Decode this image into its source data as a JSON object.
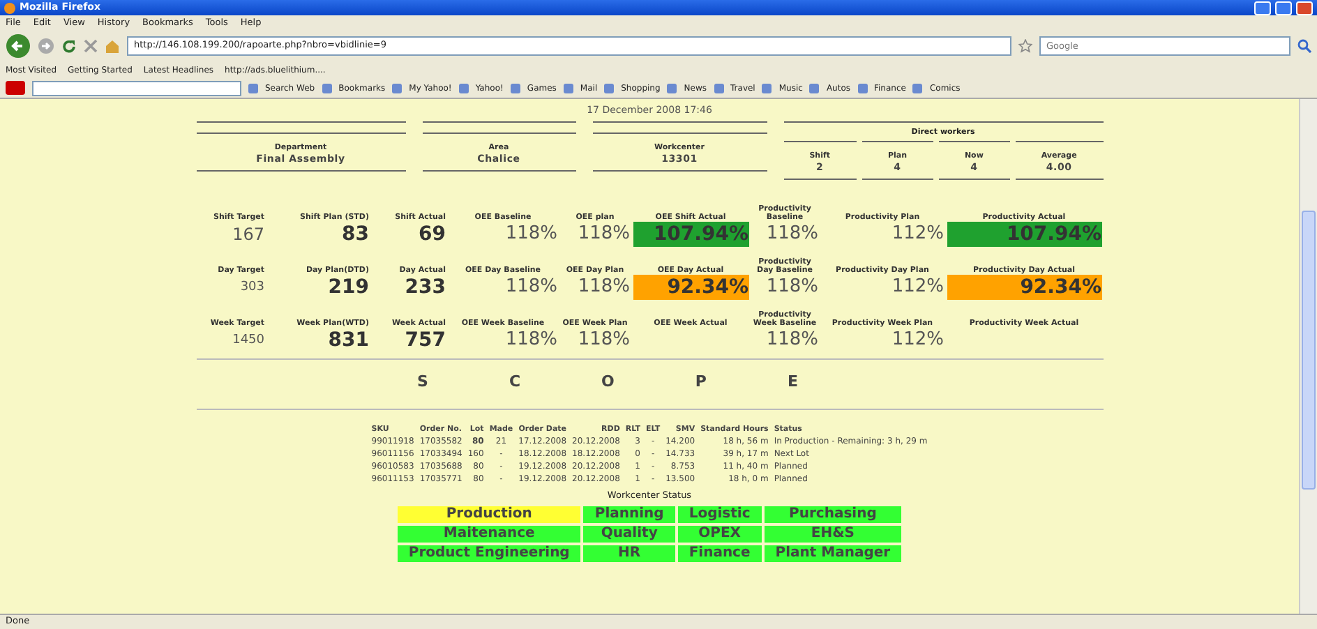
{
  "browser": {
    "title": "Mozilla Firefox",
    "menu": [
      "File",
      "Edit",
      "View",
      "History",
      "Bookmarks",
      "Tools",
      "Help"
    ],
    "url": "http://146.108.199.200/rapoarte.php?nbro=vbidlinie=9",
    "search_placeholder": "Google",
    "bookmarks": [
      "Most Visited",
      "Getting Started",
      "Latest Headlines",
      "http://ads.bluelithium...."
    ],
    "yahoo_toolbar": [
      "Search Web",
      "Bookmarks",
      "My Yahoo!",
      "Yahoo!",
      "Games",
      "Mail",
      "Shopping",
      "News",
      "Travel",
      "Music",
      "Autos",
      "Finance",
      "Comics"
    ],
    "status": "Done"
  },
  "page": {
    "timestamp": "17 December 2008 17:46",
    "info": [
      {
        "label": "Department",
        "value": "Final Assembly"
      },
      {
        "label": "Area",
        "value": "Chalice"
      },
      {
        "label": "Workcenter",
        "value": "13301"
      }
    ],
    "direct_workers": {
      "title": "Direct workers",
      "columns": [
        {
          "label": "Shift",
          "value": "2"
        },
        {
          "label": "Plan",
          "value": "4"
        },
        {
          "label": "Now",
          "value": "4"
        },
        {
          "label": "Average",
          "value": "4.00"
        }
      ]
    },
    "metrics": [
      [
        {
          "label": "Shift Target",
          "value": "167",
          "kind": "plain"
        },
        {
          "label": "Shift Plan (STD)",
          "value": "83",
          "kind": "bold"
        },
        {
          "label": "Shift Actual",
          "value": "69",
          "kind": "bold"
        },
        {
          "label": "OEE Baseline",
          "value": "118%",
          "kind": "light"
        },
        {
          "label": "OEE plan",
          "value": "118%",
          "kind": "light"
        },
        {
          "label": "OEE Shift Actual",
          "value": "107.94%",
          "kind": "status",
          "color": "#1fa12f"
        },
        {
          "label": "Productivity Baseline",
          "value": "118%",
          "kind": "light"
        },
        {
          "label": "Productivity Plan",
          "value": "112%",
          "kind": "light"
        },
        {
          "label": "Productivity Actual",
          "value": "107.94%",
          "kind": "status",
          "color": "#1fa12f"
        }
      ],
      [
        {
          "label": "Day Target",
          "value": "303",
          "kind": "small"
        },
        {
          "label": "Day Plan(DTD)",
          "value": "219",
          "kind": "bold"
        },
        {
          "label": "Day Actual",
          "value": "233",
          "kind": "bold"
        },
        {
          "label": "OEE Day Baseline",
          "value": "118%",
          "kind": "light"
        },
        {
          "label": "OEE Day Plan",
          "value": "118%",
          "kind": "light"
        },
        {
          "label": "OEE Day Actual",
          "value": "92.34%",
          "kind": "status",
          "color": "#ffa200"
        },
        {
          "label": "Productivity Day Baseline",
          "value": "118%",
          "kind": "light"
        },
        {
          "label": "Productivity Day Plan",
          "value": "112%",
          "kind": "light"
        },
        {
          "label": "Productivity Day Actual",
          "value": "92.34%",
          "kind": "status",
          "color": "#ffa200"
        }
      ],
      [
        {
          "label": "Week Target",
          "value": "1450",
          "kind": "small"
        },
        {
          "label": "Week Plan(WTD)",
          "value": "831",
          "kind": "bold"
        },
        {
          "label": "Week Actual",
          "value": "757",
          "kind": "bold"
        },
        {
          "label": "OEE Week Baseline",
          "value": "118%",
          "kind": "light"
        },
        {
          "label": "OEE Week Plan",
          "value": "118%",
          "kind": "light"
        },
        {
          "label": "OEE Week Actual"
        },
        {
          "label": "Productivity Week Baseline",
          "value": "118%",
          "kind": "light"
        },
        {
          "label": "Productivity Week Plan",
          "value": "112%",
          "kind": "light"
        },
        {
          "label": "Productivity Week Actual"
        }
      ]
    ],
    "scope": [
      "S",
      "C",
      "O",
      "P",
      "E"
    ],
    "orders": {
      "columns": [
        "SKU",
        "Order No.",
        "Lot",
        "Made",
        "Order Date",
        "RDD",
        "RLT",
        "ELT",
        "SMV",
        "Standard Hours",
        "Status"
      ],
      "rows": [
        {
          "current": true,
          "cells": [
            "99011918",
            "17035582",
            "80",
            "21",
            "17.12.2008",
            "20.12.2008",
            "3",
            "-",
            "14.200",
            "18 h, 56 m",
            "In Production - Remaining:  3 h, 29 m"
          ]
        },
        {
          "current": false,
          "cells": [
            "96011156",
            "17033494",
            "160",
            "-",
            "18.12.2008",
            "18.12.2008",
            "0",
            "-",
            "14.733",
            "39 h, 17 m",
            "Next Lot"
          ]
        },
        {
          "current": false,
          "cells": [
            "96010583",
            "17035688",
            "80",
            "-",
            "19.12.2008",
            "20.12.2008",
            "1",
            "-",
            "8.753",
            "11 h, 40 m",
            "Planned"
          ]
        },
        {
          "current": false,
          "cells": [
            "96011153",
            "17035771",
            "80",
            "-",
            "19.12.2008",
            "20.12.2008",
            "1",
            "-",
            "13.500",
            "18 h, 0 m",
            "Planned"
          ]
        }
      ]
    },
    "workcenter_status": {
      "title": "Workcenter Status",
      "rows": [
        [
          {
            "label": "Production",
            "color": "#ffff33"
          },
          {
            "label": "Planning",
            "color": "#33ff33"
          },
          {
            "label": "Logistic",
            "color": "#33ff33"
          },
          {
            "label": "Purchasing",
            "color": "#33ff33"
          }
        ],
        [
          {
            "label": "Maitenance",
            "color": "#33ff33"
          },
          {
            "label": "Quality",
            "color": "#33ff33"
          },
          {
            "label": "OPEX",
            "color": "#33ff33"
          },
          {
            "label": "EH&S",
            "color": "#33ff33"
          }
        ],
        [
          {
            "label": "Product Engineering",
            "color": "#33ff33"
          },
          {
            "label": "HR",
            "color": "#33ff33"
          },
          {
            "label": "Finance",
            "color": "#33ff33"
          },
          {
            "label": "Plant Manager",
            "color": "#33ff33"
          }
        ]
      ]
    }
  }
}
